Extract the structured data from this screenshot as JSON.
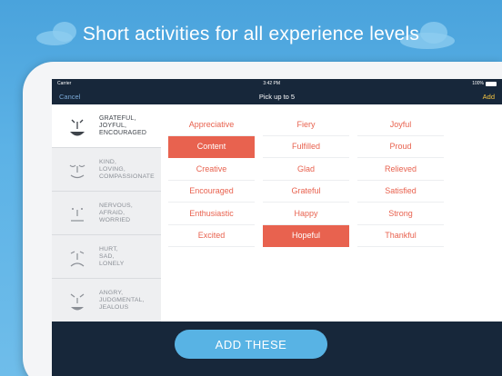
{
  "headline": "Short activities for all experience levels",
  "status_bar": {
    "carrier": "Carrier",
    "time": "3:42 PM",
    "battery": "100%"
  },
  "nav": {
    "cancel": "Cancel",
    "title": "Pick up to 5",
    "add": "Add"
  },
  "categories": [
    {
      "label": "GRATEFUL,\nJOYFUL,\nENCOURAGED",
      "face": "grateful-face-icon",
      "active": true
    },
    {
      "label": "KIND,\nLOVING,\nCOMPASSIONATE",
      "face": "kind-face-icon",
      "active": false
    },
    {
      "label": "NERVOUS,\nAFRAID,\nWORRIED",
      "face": "nervous-face-icon",
      "active": false
    },
    {
      "label": "HURT,\nSAD,\nLONELY",
      "face": "sad-face-icon",
      "active": false
    },
    {
      "label": "ANGRY,\nJUDGMENTAL,\nJEALOUS",
      "face": "angry-face-icon",
      "active": false
    }
  ],
  "words": [
    {
      "text": "Appreciative",
      "selected": false
    },
    {
      "text": "Fiery",
      "selected": false
    },
    {
      "text": "Joyful",
      "selected": false
    },
    {
      "text": "Content",
      "selected": true
    },
    {
      "text": "Fulfilled",
      "selected": false
    },
    {
      "text": "Proud",
      "selected": false
    },
    {
      "text": "Creative",
      "selected": false
    },
    {
      "text": "Glad",
      "selected": false
    },
    {
      "text": "Relieved",
      "selected": false
    },
    {
      "text": "Encouraged",
      "selected": false
    },
    {
      "text": "Grateful",
      "selected": false
    },
    {
      "text": "Satisfied",
      "selected": false
    },
    {
      "text": "Enthusiastic",
      "selected": false
    },
    {
      "text": "Happy",
      "selected": false
    },
    {
      "text": "Strong",
      "selected": false
    },
    {
      "text": "Excited",
      "selected": false
    },
    {
      "text": "Hopeful",
      "selected": true
    },
    {
      "text": "Thankful",
      "selected": false
    }
  ],
  "footer": {
    "button_label": "ADD THESE"
  },
  "colors": {
    "accent": "#e8624f",
    "background_blue": "#4aa3dc",
    "navbar": "#17273a",
    "button_blue": "#58b3e4",
    "add_yellow": "#f5c542"
  }
}
